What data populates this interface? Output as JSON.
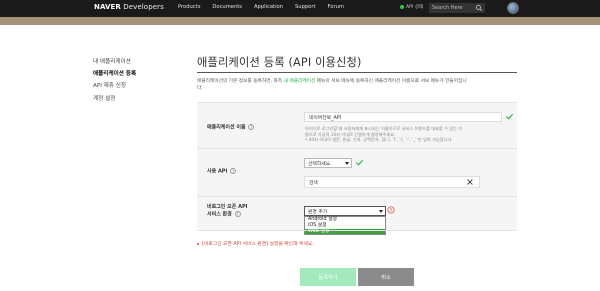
{
  "brand": {
    "bold": "NAVER",
    "thin": "Developers"
  },
  "nav": [
    "Products",
    "Documents",
    "Application",
    "Support",
    "Forum"
  ],
  "api_status": "API 상태",
  "search": {
    "placeholder": "Search Here"
  },
  "sidebar": [
    {
      "label": "내 애플리케이션",
      "active": false
    },
    {
      "label": "애플리케이션 등록",
      "active": true
    },
    {
      "label": "API 제휴 신청",
      "active": false
    },
    {
      "label": "계정 설정",
      "active": false
    }
  ],
  "page": {
    "title": "애플리케이션 등록 (API 이용신청)",
    "desc_1": "애플리케이션의 기본 정보를 등록하면, 좌측 ",
    "desc_link": "내 애플리케이션",
    "desc_2": " 메뉴의 서브 메뉴에 등록하신 애플리케이션 이름으로 서브 메뉴가 만들어집니",
    "desc_3": "다."
  },
  "form": {
    "app_name": {
      "label": "애플리케이션 이름",
      "value": "네이버전북_API",
      "hints": [
        "아이디로 로그인할 때 사용자에게 표시되는 이름이므로 서비스 브랜드를 대표할 수 있는 이",
        "름으로 가급적 10자 이내로 간결하게 설정해주세요.",
        "• 40자 이내의 영문, 한글, 숫자, 공백문자, 점(.), '(', ')', '-', '_' 만 입력 가능합니다."
      ]
    },
    "usage_api": {
      "label": "사용 API",
      "select_value": "선택하세요.",
      "selected_item": "검색"
    },
    "env": {
      "label_1": "비로그인 오픈 API",
      "label_2": "서비스 환경",
      "select_value": "환경 추가",
      "options": [
        "Android 설정",
        "iOS 설정",
        "WEB 설정"
      ]
    }
  },
  "error": "[비로그인 오픈 API 서비스 환경] 설정을 확인해 주세요.",
  "buttons": {
    "register": "등록하기",
    "cancel": "취소"
  },
  "colors": {
    "accent": "#19b33f",
    "topbar": "#1a1a1a",
    "band": "#a39277",
    "error": "#d84a3a",
    "register_bg": "#a4e8bd",
    "cancel_bg": "#8b8b8b"
  }
}
